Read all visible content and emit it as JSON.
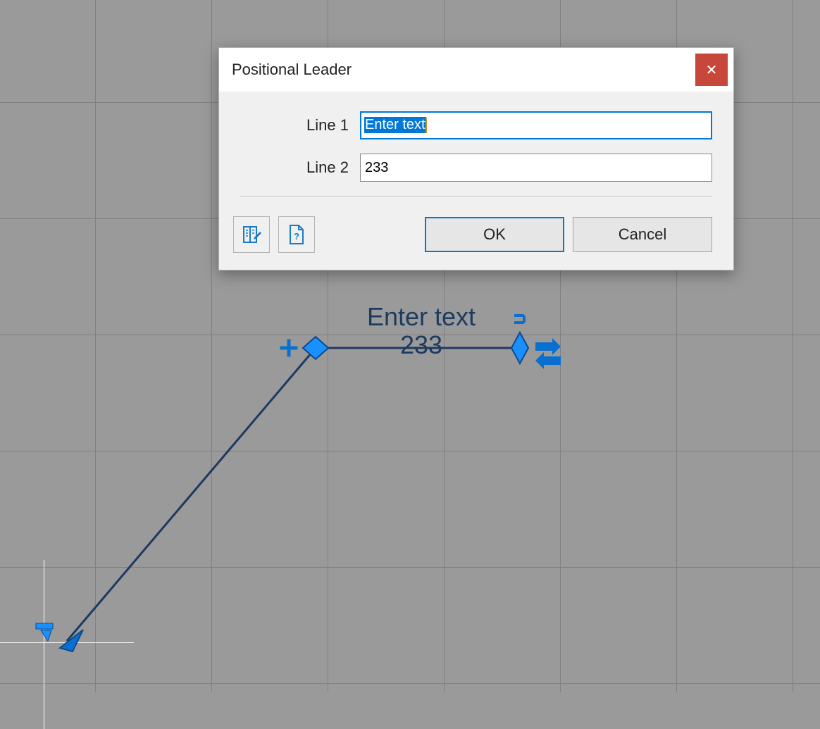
{
  "dialog": {
    "title": "Positional Leader",
    "close_label": "✕",
    "line1_label": "Line 1",
    "line1_value": "Enter text",
    "line2_label": "Line 2",
    "line2_value": "233",
    "ok_label": "OK",
    "cancel_label": "Cancel"
  },
  "canvas": {
    "leader_top_text": "Enter text",
    "leader_bottom_text": "233"
  }
}
